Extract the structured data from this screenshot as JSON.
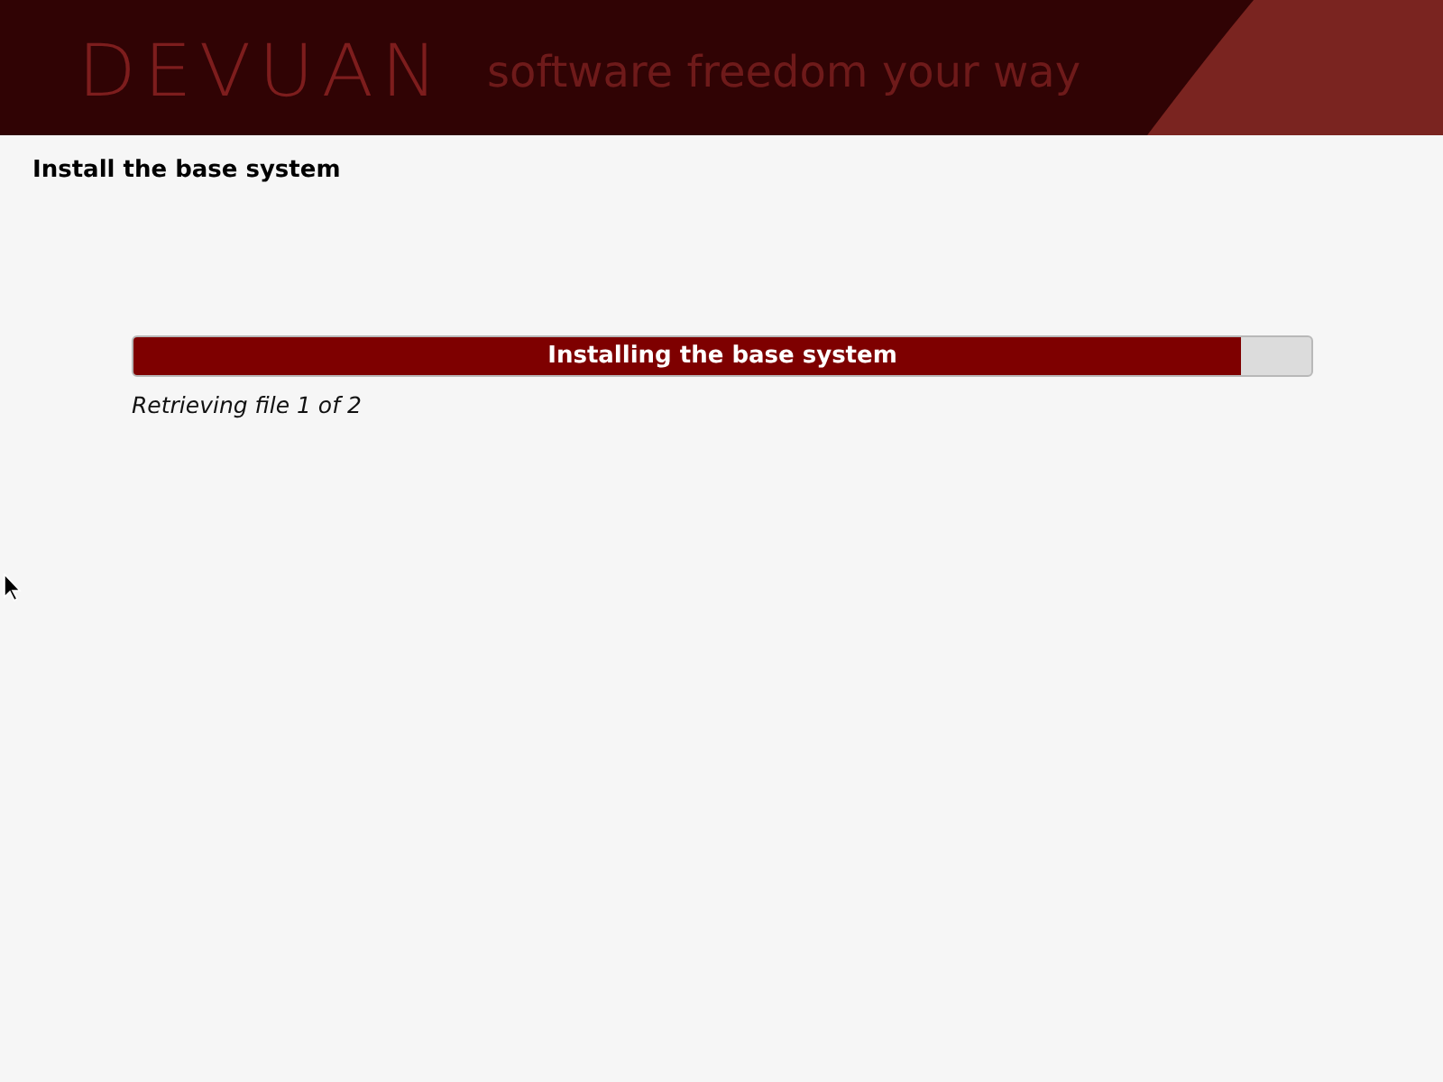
{
  "header": {
    "logo": "DEVUAN",
    "tagline": "software freedom your way"
  },
  "page": {
    "title": "Install the base system"
  },
  "progress": {
    "label": "Installing the base system",
    "level": 0.94,
    "status": "Retrieving file 1 of 2"
  }
}
